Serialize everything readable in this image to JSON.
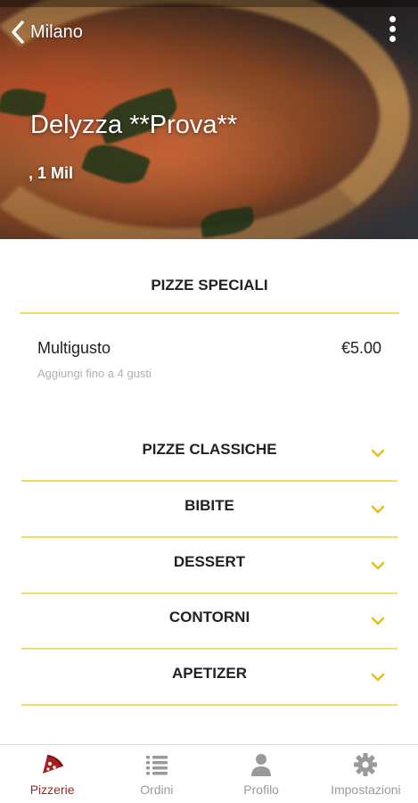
{
  "header": {
    "back_label": "Milano",
    "title": "Delyzza **Prova**",
    "subtitle": ", 1 Mil"
  },
  "menu": {
    "featured_section": "PIZZE SPECIALI",
    "featured_item": {
      "name": "Multigusto",
      "price": "€5.00",
      "description": "Aggiungi fino a 4 gusti"
    },
    "categories": [
      {
        "label": "PIZZE CLASSICHE"
      },
      {
        "label": "BIBITE"
      },
      {
        "label": "DESSERT"
      },
      {
        "label": "CONTORNI"
      },
      {
        "label": "APETIZER"
      }
    ]
  },
  "bottom_nav": [
    {
      "label": "Pizzerie",
      "icon": "pizza-slice-icon",
      "active": true
    },
    {
      "label": "Ordini",
      "icon": "list-icon",
      "active": false
    },
    {
      "label": "Profilo",
      "icon": "person-icon",
      "active": false
    },
    {
      "label": "Impostazioni",
      "icon": "gear-icon",
      "active": false
    }
  ],
  "colors": {
    "accent": "#f1de6b",
    "chevron": "#e3c01f",
    "active_nav": "#a62121",
    "inactive_nav": "#9a9a9a"
  }
}
